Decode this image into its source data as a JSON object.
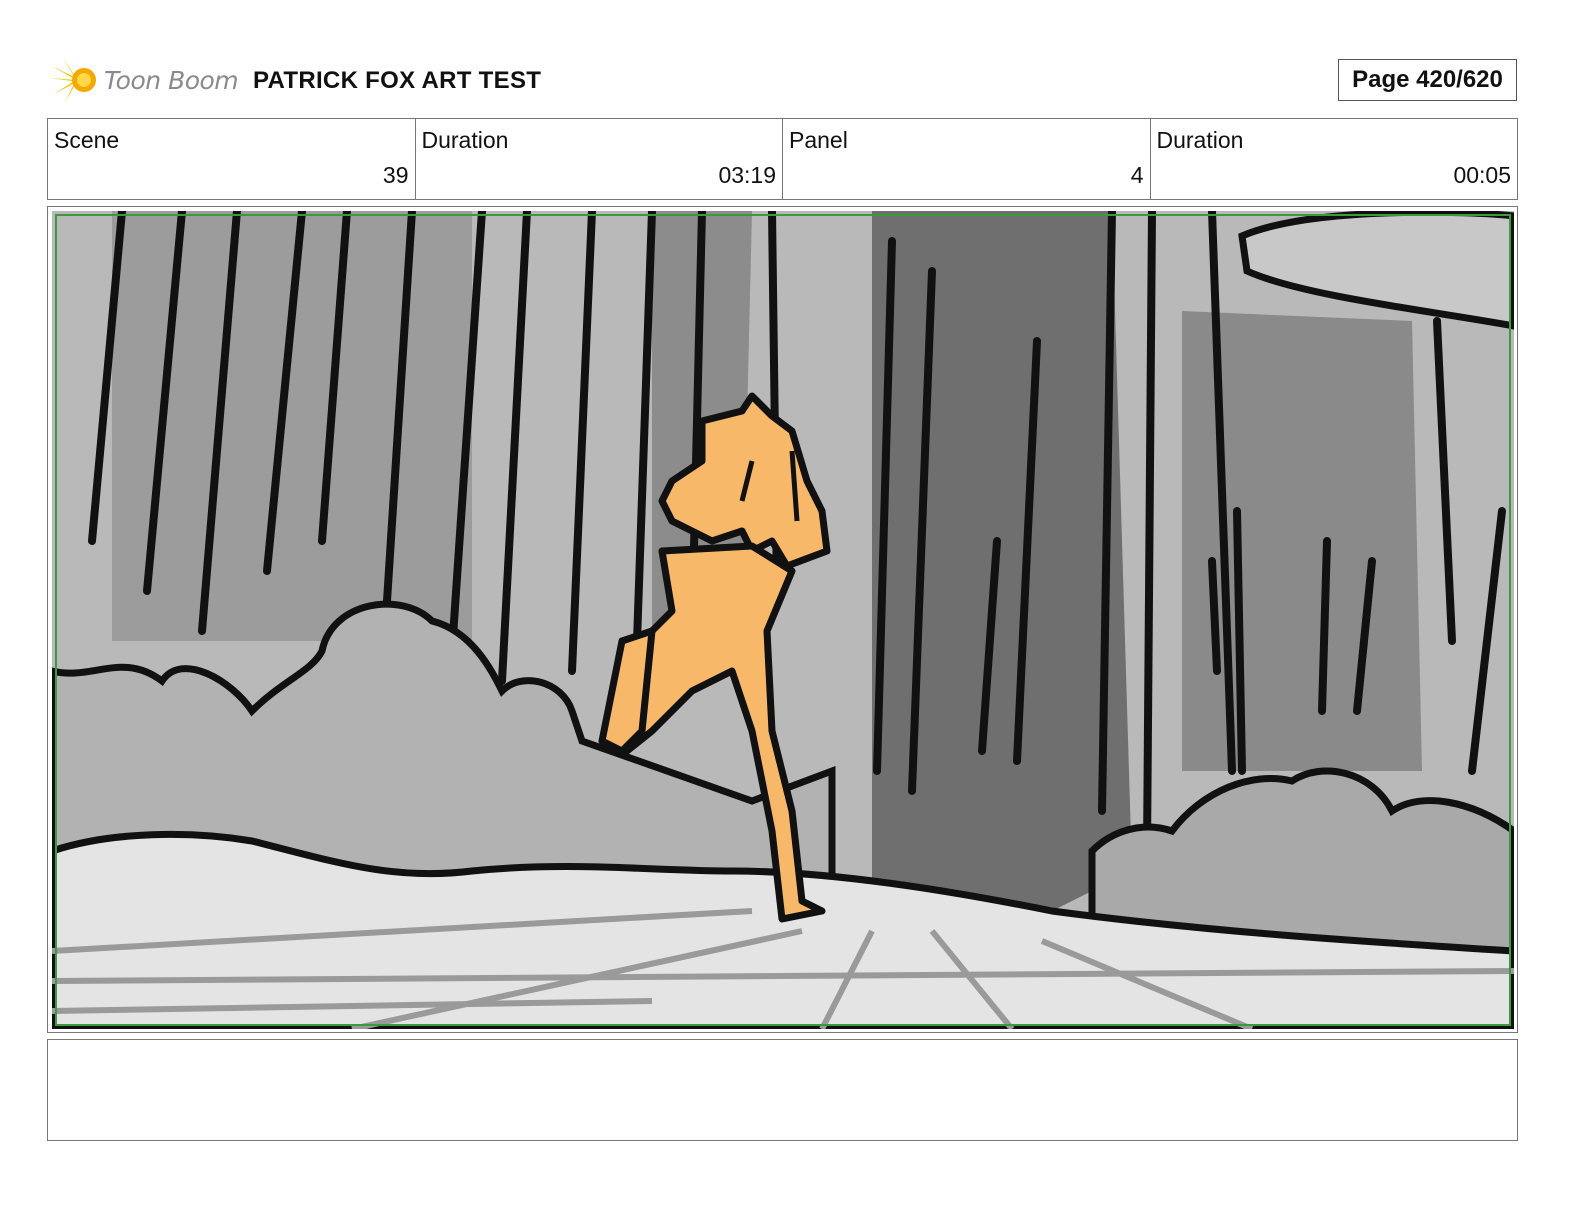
{
  "header": {
    "logo_text": "Toon Boom",
    "project_title": "PATRICK FOX ART TEST",
    "page_label": "Page 420/620"
  },
  "info": {
    "scene_label": "Scene",
    "scene_value": "39",
    "scene_duration_label": "Duration",
    "scene_duration_value": "03:19",
    "panel_label": "Panel",
    "panel_value": "4",
    "panel_duration_label": "Duration",
    "panel_duration_value": "00:05"
  },
  "panel": {
    "icon": "storyboard-sketch-runner-in-forest",
    "colors": {
      "skin": "#f8b86a",
      "line": "#111111",
      "safe_frame": "#3c9a3c"
    }
  },
  "notes": {
    "text": ""
  }
}
